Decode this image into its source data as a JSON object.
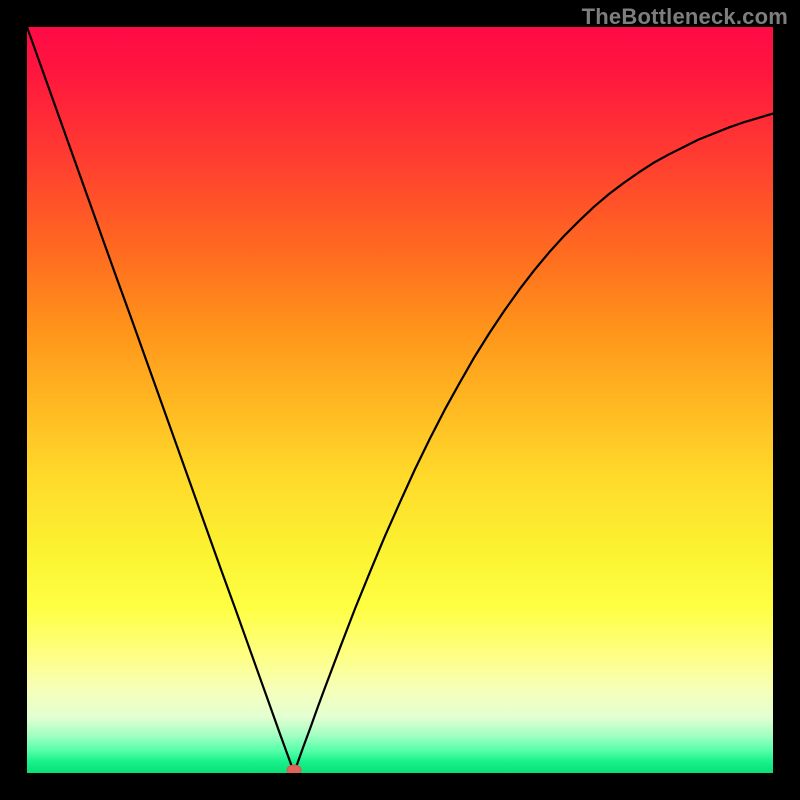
{
  "watermark": "TheBottleneck.com",
  "chart_data": {
    "type": "line",
    "title": "",
    "xlabel": "",
    "ylabel": "",
    "xlim": [
      0,
      1
    ],
    "ylim": [
      0,
      1
    ],
    "grid": false,
    "curve": [
      {
        "x": 0.0,
        "y": 1.0
      },
      {
        "x": 0.02,
        "y": 0.944
      },
      {
        "x": 0.04,
        "y": 0.888
      },
      {
        "x": 0.06,
        "y": 0.832
      },
      {
        "x": 0.08,
        "y": 0.776
      },
      {
        "x": 0.1,
        "y": 0.72
      },
      {
        "x": 0.12,
        "y": 0.664
      },
      {
        "x": 0.14,
        "y": 0.609
      },
      {
        "x": 0.16,
        "y": 0.553
      },
      {
        "x": 0.18,
        "y": 0.497
      },
      {
        "x": 0.2,
        "y": 0.441
      },
      {
        "x": 0.22,
        "y": 0.385
      },
      {
        "x": 0.24,
        "y": 0.329
      },
      {
        "x": 0.26,
        "y": 0.273
      },
      {
        "x": 0.28,
        "y": 0.218
      },
      {
        "x": 0.3,
        "y": 0.162
      },
      {
        "x": 0.32,
        "y": 0.106
      },
      {
        "x": 0.34,
        "y": 0.05
      },
      {
        "x": 0.356,
        "y": 0.006
      },
      {
        "x": 0.358,
        "y": 0.0
      },
      {
        "x": 0.36,
        "y": 0.006
      },
      {
        "x": 0.37,
        "y": 0.034
      },
      {
        "x": 0.38,
        "y": 0.061
      },
      {
        "x": 0.39,
        "y": 0.089
      },
      {
        "x": 0.4,
        "y": 0.116
      },
      {
        "x": 0.42,
        "y": 0.169
      },
      {
        "x": 0.44,
        "y": 0.221
      },
      {
        "x": 0.46,
        "y": 0.27
      },
      {
        "x": 0.48,
        "y": 0.318
      },
      {
        "x": 0.5,
        "y": 0.363
      },
      {
        "x": 0.52,
        "y": 0.407
      },
      {
        "x": 0.54,
        "y": 0.448
      },
      {
        "x": 0.56,
        "y": 0.487
      },
      {
        "x": 0.58,
        "y": 0.523
      },
      {
        "x": 0.6,
        "y": 0.558
      },
      {
        "x": 0.62,
        "y": 0.59
      },
      {
        "x": 0.64,
        "y": 0.62
      },
      {
        "x": 0.66,
        "y": 0.648
      },
      {
        "x": 0.68,
        "y": 0.674
      },
      {
        "x": 0.7,
        "y": 0.698
      },
      {
        "x": 0.72,
        "y": 0.72
      },
      {
        "x": 0.74,
        "y": 0.74
      },
      {
        "x": 0.76,
        "y": 0.759
      },
      {
        "x": 0.78,
        "y": 0.776
      },
      {
        "x": 0.8,
        "y": 0.791
      },
      {
        "x": 0.82,
        "y": 0.805
      },
      {
        "x": 0.84,
        "y": 0.818
      },
      {
        "x": 0.86,
        "y": 0.829
      },
      {
        "x": 0.88,
        "y": 0.839
      },
      {
        "x": 0.9,
        "y": 0.849
      },
      {
        "x": 0.92,
        "y": 0.857
      },
      {
        "x": 0.94,
        "y": 0.865
      },
      {
        "x": 0.96,
        "y": 0.872
      },
      {
        "x": 0.98,
        "y": 0.878
      },
      {
        "x": 1.0,
        "y": 0.884
      }
    ],
    "marker": {
      "x": 0.358,
      "y": 0.0,
      "color": "#e1645a"
    },
    "background_gradient": {
      "top": "#ff0a47",
      "bottom": "#08e078"
    }
  }
}
